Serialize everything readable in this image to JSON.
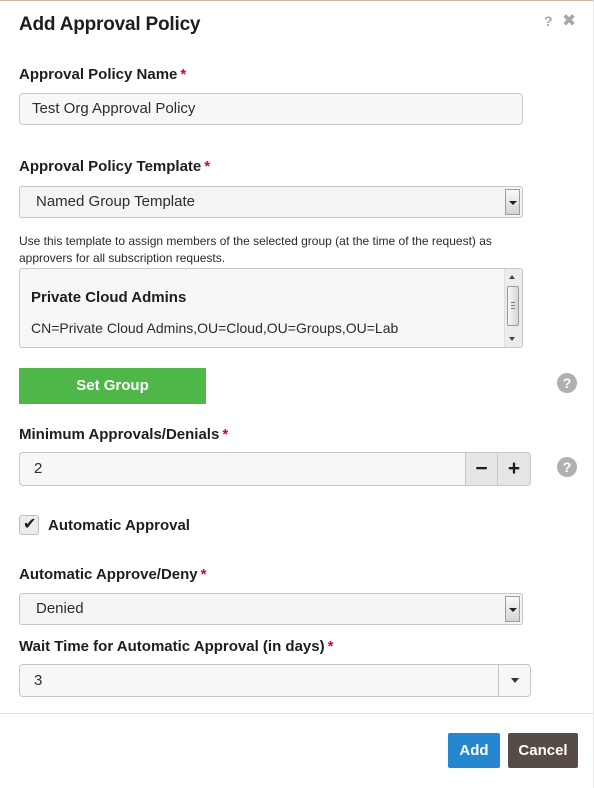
{
  "dialog": {
    "title": "Add Approval Policy",
    "help_glyph": "?",
    "close_glyph": "✖"
  },
  "fields": {
    "required_marker": "*",
    "policy_name": {
      "label": "Approval Policy Name",
      "value": "Test Org Approval Policy"
    },
    "policy_template": {
      "label": "Approval Policy Template",
      "selected": "Named Group Template",
      "description": "Use this template to assign members of the selected group (at the time of the request) as approvers for all subscription requests."
    },
    "group_list": {
      "name": "Private Cloud Admins",
      "dn": "CN=Private Cloud Admins,OU=Cloud,OU=Groups,OU=Lab"
    },
    "set_group_label": "Set Group",
    "min_approvals": {
      "label": "Minimum Approvals/Denials",
      "value": "2",
      "minus": "−",
      "plus": "+"
    },
    "automatic_approval": {
      "label": "Automatic Approval",
      "checked": true,
      "check_glyph": "✔"
    },
    "auto_approve_deny": {
      "label": "Automatic Approve/Deny",
      "selected": "Denied"
    },
    "wait_time": {
      "label": "Wait Time for Automatic Approval (in days)",
      "selected": "3"
    }
  },
  "help_icon_glyph": "?",
  "footer": {
    "add_label": "Add",
    "cancel_label": "Cancel"
  },
  "colors": {
    "required": "#e2001a",
    "set_group_button": "#4fb748",
    "add_button": "#2487d0",
    "cancel_button": "#564c45",
    "help_icon": "#b0b0b0"
  }
}
